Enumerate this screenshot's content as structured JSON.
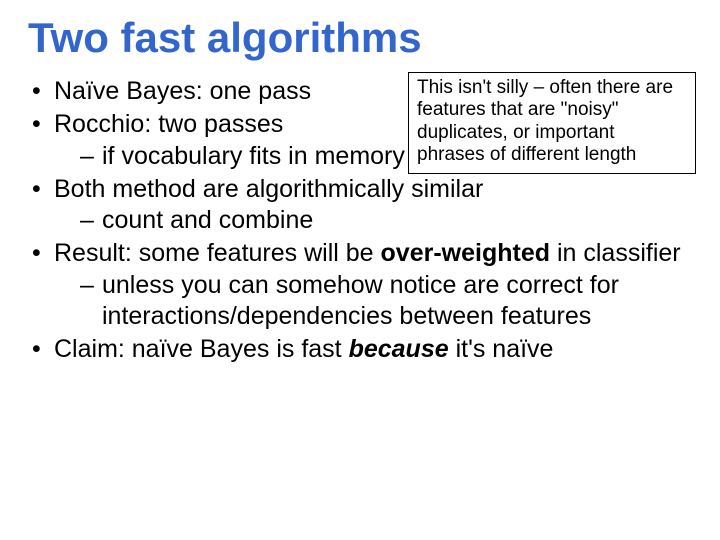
{
  "title": "Two fast algorithms",
  "callout": "This isn't silly – often there are features that are \"noisy\" duplicates, or important phrases of different length",
  "bullets": {
    "b1": "Naïve Bayes: one pass",
    "b2": "Rocchio: two passes",
    "b2s1": "if vocabulary fits in memory",
    "b3": "Both method are algorithmically similar",
    "b3s1": "count and combine",
    "b4_pre": "Result: some features will be ",
    "b4_bold": "over-weighted",
    "b4_post": " in classifier",
    "b4s1": "unless you can somehow notice are correct for interactions/dependencies between features",
    "b5_pre": "Claim: naïve Bayes is fast ",
    "b5_bold": "because",
    "b5_post": " it's naïve"
  }
}
